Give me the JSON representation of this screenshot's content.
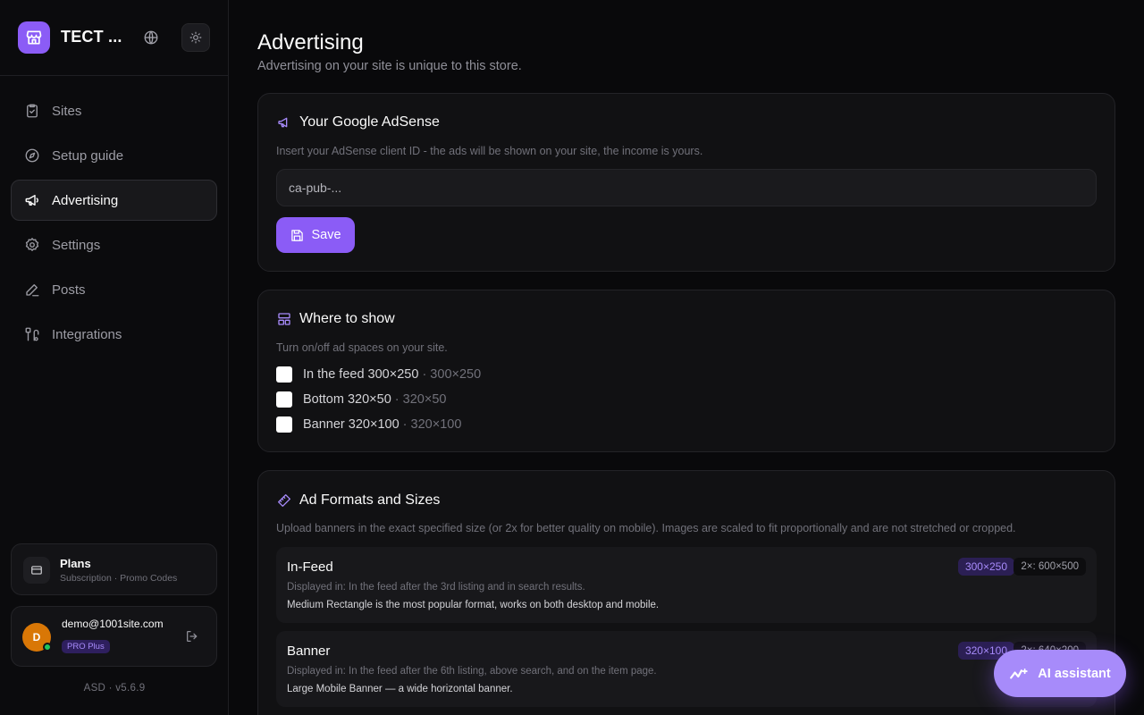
{
  "sidebar": {
    "brand": "TECT ...",
    "nav": [
      {
        "label": "Sites",
        "icon": "clipboard-check-icon"
      },
      {
        "label": "Setup guide",
        "icon": "compass-icon"
      },
      {
        "label": "Advertising",
        "icon": "megaphone-icon",
        "active": true
      },
      {
        "label": "Settings",
        "icon": "gear-icon"
      },
      {
        "label": "Posts",
        "icon": "pencil-icon"
      },
      {
        "label": "Integrations",
        "icon": "integrations-icon"
      }
    ],
    "plans": {
      "title": "Plans",
      "subtitle": "Subscription · Promo Codes"
    },
    "user": {
      "initial": "D",
      "email": "demo@1001site.com",
      "badge": "PRO Plus"
    },
    "version": "ASD · v5.6.9"
  },
  "page": {
    "title": "Advertising",
    "subtitle": "Advertising on your site is unique to this store."
  },
  "adsense": {
    "title": "Your Google AdSense",
    "description": "Insert your AdSense client ID - the ads will be shown on your site, the income is yours.",
    "placeholder": "ca-pub-...",
    "save_label": "Save"
  },
  "where": {
    "title": "Where to show",
    "description": "Turn on/off ad spaces on your site.",
    "options": [
      {
        "label": "In the feed 300×250",
        "size": "· 300×250",
        "checked": false
      },
      {
        "label": "Bottom 320×50",
        "size": "· 320×50",
        "checked": false
      },
      {
        "label": "Banner 320×100",
        "size": "· 320×100",
        "checked": false
      }
    ]
  },
  "formats": {
    "title": "Ad Formats and Sizes",
    "description": "Upload banners in the exact specified size (or 2x for better quality on mobile). Images are scaled to fit proportionally and are not stretched or cropped.",
    "items": [
      {
        "name": "In-Feed",
        "size": "300×250",
        "size2x": "2×: 600×500",
        "where": "Displayed in: In the feed after the 3rd listing and in search results.",
        "desc": "Medium Rectangle is the most popular format, works on both desktop and mobile."
      },
      {
        "name": "Banner",
        "size": "320×100",
        "size2x": "2×: 640×200",
        "where": "Displayed in: In the feed after the 6th listing, above search, and on the item page.",
        "desc": "Large Mobile Banner — a wide horizontal banner."
      }
    ]
  },
  "ai_button": {
    "label": "AI assistant"
  },
  "colors": {
    "accent": "#8b5cf6",
    "background": "#09090b",
    "card": "#111113"
  }
}
